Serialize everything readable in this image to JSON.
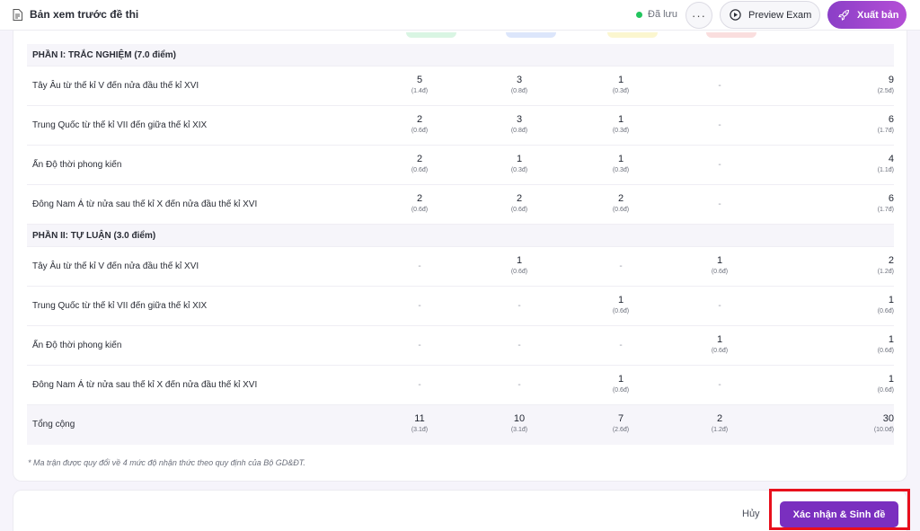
{
  "header": {
    "title": "Bản xem trước đề thi",
    "saved_status": "Đã lưu",
    "more_label": "···",
    "preview_label": "Preview Exam",
    "export_label": "Xuất bản",
    "colors": {
      "accent": "#8b3fc7",
      "saved_dot": "#22c55e"
    }
  },
  "level_pills": [
    {
      "color": "#d9f5e3"
    },
    {
      "color": "#dce6fb"
    },
    {
      "color": "#fbf6cf"
    },
    {
      "color": "#fadede"
    }
  ],
  "sections": [
    {
      "title": "PHẦN I: TRẮC NGHIỆM (7.0 điểm)",
      "rows": [
        {
          "label": "Tây Âu từ thế kỉ V đến nửa đầu thế kỉ XVI",
          "cells": [
            {
              "count": "5",
              "pts": "(1.4đ)"
            },
            {
              "count": "3",
              "pts": "(0.8đ)"
            },
            {
              "count": "1",
              "pts": "(0.3đ)"
            },
            {
              "dash": "-"
            },
            {
              "count": "9",
              "pts": "(2.5đ)"
            }
          ]
        },
        {
          "label": "Trung Quốc từ thế kỉ VII đến giữa thế kỉ XIX",
          "cells": [
            {
              "count": "2",
              "pts": "(0.6đ)"
            },
            {
              "count": "3",
              "pts": "(0.8đ)"
            },
            {
              "count": "1",
              "pts": "(0.3đ)"
            },
            {
              "dash": "-"
            },
            {
              "count": "6",
              "pts": "(1.7đ)"
            }
          ]
        },
        {
          "label": "Ấn Độ thời phong kiến",
          "cells": [
            {
              "count": "2",
              "pts": "(0.6đ)"
            },
            {
              "count": "1",
              "pts": "(0.3đ)"
            },
            {
              "count": "1",
              "pts": "(0.3đ)"
            },
            {
              "dash": "-"
            },
            {
              "count": "4",
              "pts": "(1.1đ)"
            }
          ]
        },
        {
          "label": "Đông Nam Á từ nửa sau thế kỉ X đến nửa đầu thế kỉ XVI",
          "cells": [
            {
              "count": "2",
              "pts": "(0.6đ)"
            },
            {
              "count": "2",
              "pts": "(0.6đ)"
            },
            {
              "count": "2",
              "pts": "(0.6đ)"
            },
            {
              "dash": "-"
            },
            {
              "count": "6",
              "pts": "(1.7đ)"
            }
          ]
        }
      ]
    },
    {
      "title": "PHẦN II: TỰ LUẬN (3.0 điểm)",
      "rows": [
        {
          "label": "Tây Âu từ thế kỉ V đến nửa đầu thế kỉ XVI",
          "cells": [
            {
              "dash": "-"
            },
            {
              "count": "1",
              "pts": "(0.6đ)"
            },
            {
              "dash": "-"
            },
            {
              "count": "1",
              "pts": "(0.6đ)"
            },
            {
              "count": "2",
              "pts": "(1.2đ)"
            }
          ]
        },
        {
          "label": "Trung Quốc từ thế kỉ VII đến giữa thế kỉ XIX",
          "cells": [
            {
              "dash": "-"
            },
            {
              "dash": "-"
            },
            {
              "count": "1",
              "pts": "(0.6đ)"
            },
            {
              "dash": "-"
            },
            {
              "count": "1",
              "pts": "(0.6đ)"
            }
          ]
        },
        {
          "label": "Ấn Độ thời phong kiến",
          "cells": [
            {
              "dash": "-"
            },
            {
              "dash": "-"
            },
            {
              "dash": "-"
            },
            {
              "count": "1",
              "pts": "(0.6đ)"
            },
            {
              "count": "1",
              "pts": "(0.6đ)"
            }
          ]
        },
        {
          "label": "Đông Nam Á từ nửa sau thế kỉ X đến nửa đầu thế kỉ XVI",
          "cells": [
            {
              "dash": "-"
            },
            {
              "dash": "-"
            },
            {
              "count": "1",
              "pts": "(0.6đ)"
            },
            {
              "dash": "-"
            },
            {
              "count": "1",
              "pts": "(0.6đ)"
            }
          ]
        }
      ]
    }
  ],
  "total": {
    "label": "Tổng cộng",
    "cells": [
      {
        "count": "11",
        "pts": "(3.1đ)"
      },
      {
        "count": "10",
        "pts": "(3.1đ)"
      },
      {
        "count": "7",
        "pts": "(2.6đ)"
      },
      {
        "count": "2",
        "pts": "(1.2đ)"
      },
      {
        "count": "30",
        "pts": "(10.0đ)"
      }
    ]
  },
  "note": "* Ma trận được quy đổi về 4 mức độ nhận thức theo quy định của Bộ GD&ĐT.",
  "footer": {
    "cancel_label": "Hủy",
    "confirm_label": "Xác nhận & Sinh đề",
    "confirm_color": "#7a2fbf",
    "highlight_color": "#e8101c"
  }
}
